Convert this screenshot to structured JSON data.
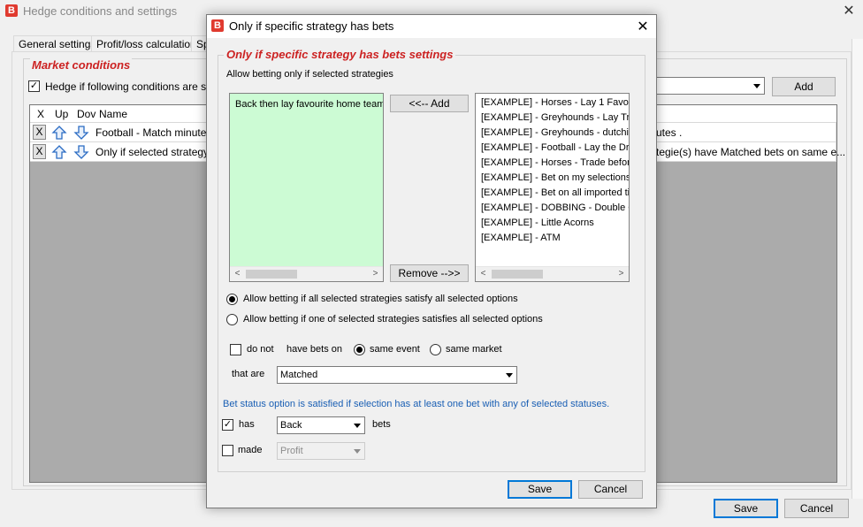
{
  "main_window": {
    "icon": "B",
    "title": "Hedge conditions and settings",
    "close_glyph": "✕",
    "tabs": [
      "General settings",
      "Profit/loss calculation",
      "Sp"
    ],
    "section_title": "Market conditions",
    "hedge_checkbox_label": "Hedge if following conditions are satisfi",
    "add_label": "Add",
    "columns": [
      "X",
      "Up",
      "Dov",
      "Name"
    ],
    "rows": [
      {
        "x": "X",
        "name": "Football - Match minute",
        "right_text": "utes ."
      },
      {
        "x": "X",
        "name": "Only if selected strategy ha",
        "right_text": "tegie(s) have Matched bets on same e..."
      }
    ],
    "save_label": "Save",
    "cancel_label": "Cancel"
  },
  "dialog": {
    "icon": "B",
    "title": "Only if specific strategy has bets",
    "close_glyph": "✕",
    "heading": "Only if specific strategy has bets settings",
    "allow_label": "Allow betting only if selected strategies",
    "selected_strategies": [
      "Back then lay  favourite home team"
    ],
    "add_button": "<<-- Add",
    "remove_button": "Remove -->>",
    "available_strategies": [
      "[EXAMPLE] - Horses - Lay 1 Favou",
      "[EXAMPLE] - Greyhounds - Lay Tra",
      "[EXAMPLE] - Greyhounds - dutchin",
      "[EXAMPLE] - Football - Lay the Dra",
      "[EXAMPLE] - Horses - Trade before",
      "[EXAMPLE] - Bet on my selections",
      "[EXAMPLE] - Bet on all imported tip",
      "[EXAMPLE] - DOBBING - Double C",
      "[EXAMPLE] - Little Acorns",
      "[EXAMPLE] - ATM"
    ],
    "radio_all": "Allow betting if all selected strategies satisfy all selected options",
    "radio_one": "Allow betting if one of selected strategies satisfies all selected options",
    "do_not_label": "do not",
    "have_bets_on_label": "have bets on",
    "same_event_label": "same event",
    "same_market_label": "same market",
    "that_are_label": "that are",
    "that_are_value": "Matched",
    "info_text": "Bet status option is satisfied if selection has at least one bet with any of selected statuses.",
    "has_label": "has",
    "has_value": "Back",
    "bets_label": "bets",
    "made_label": "made",
    "made_value": "Profit",
    "save_label": "Save",
    "cancel_label": "Cancel"
  }
}
